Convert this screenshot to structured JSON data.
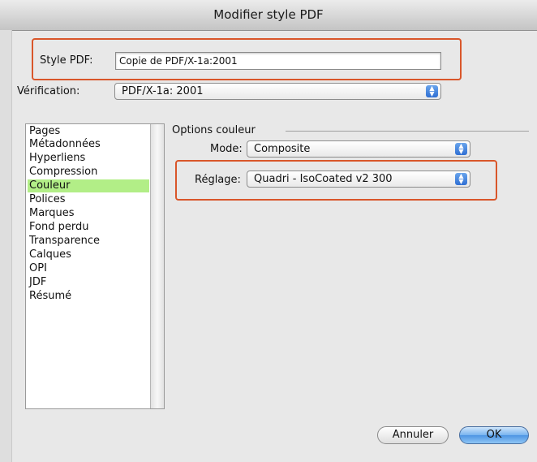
{
  "window": {
    "title": "Modifier style PDF"
  },
  "style": {
    "label": "Style PDF:",
    "value": "Copie de PDF/X-1a:2001"
  },
  "verification": {
    "label": "Vérification:",
    "value": "PDF/X-1a: 2001"
  },
  "sections": [
    "Pages",
    "Métadonnées",
    "Hyperliens",
    "Compression",
    "Couleur",
    "Polices",
    "Marques",
    "Fond perdu",
    "Transparence",
    "Calques",
    "OPI",
    "JDF",
    "Résumé"
  ],
  "selected_section": "Couleur",
  "color_options": {
    "group_title": "Options couleur",
    "mode_label": "Mode:",
    "mode_value": "Composite",
    "reglage_label": "Réglage:",
    "reglage_value": "Quadri - IsoCoated v2 300"
  },
  "buttons": {
    "cancel": "Annuler",
    "ok": "OK"
  },
  "colors": {
    "highlight": "#d9562a",
    "selection": "#b2ee87",
    "accent": "#4e95e3"
  }
}
